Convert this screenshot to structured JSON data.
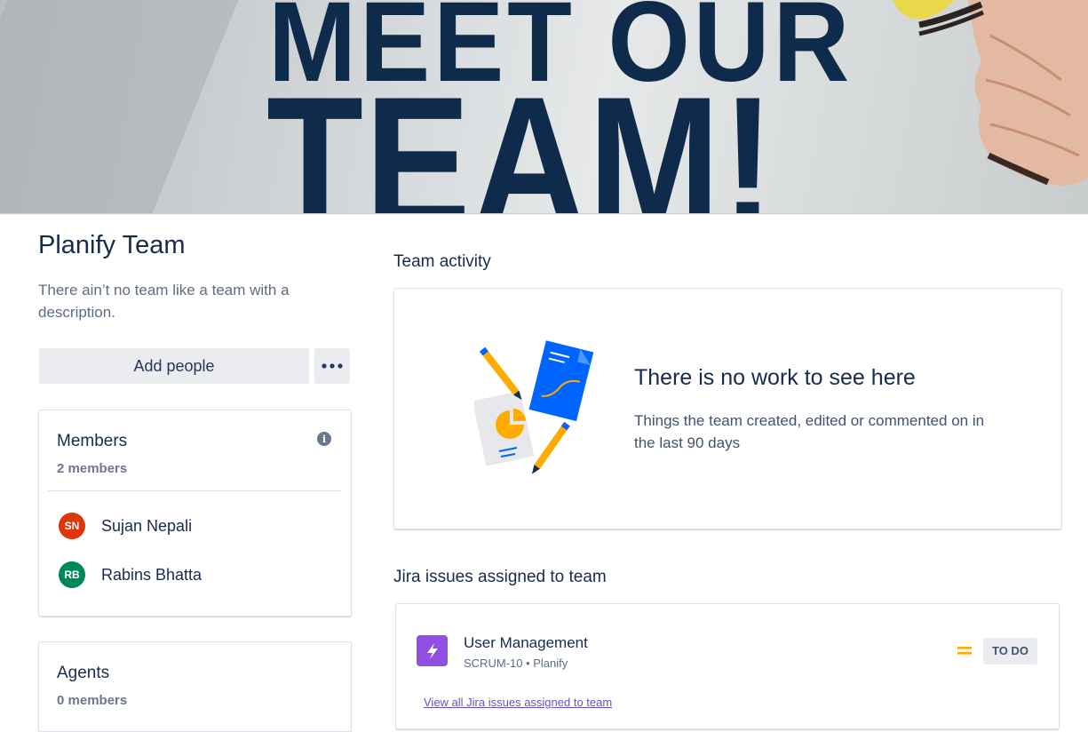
{
  "banner": {
    "line1": "MEET OUR",
    "line2": "TEAM!"
  },
  "team": {
    "name": "Planify Team",
    "description": "There ain’t no team like a team with a description.",
    "add_people_label": "Add people"
  },
  "members": {
    "title": "Members",
    "count": "2 members",
    "list": [
      {
        "initials": "SN",
        "name": "Sujan Nepali",
        "color": "#DE350B"
      },
      {
        "initials": "RB",
        "name": "Rabins Bhatta",
        "color": "#00875A"
      }
    ]
  },
  "agents": {
    "title": "Agents",
    "count": "0 members"
  },
  "activity": {
    "title": "Team activity",
    "empty_title": "There is no work to see here",
    "empty_desc": "Things the team created, edited or commented on in the last 90 days"
  },
  "issues": {
    "title": "Jira issues assigned to team",
    "items": [
      {
        "title": "User Management",
        "meta": "SCRUM-10 • Planify",
        "status": "TO DO",
        "icon": "epic-lightning-icon",
        "priority_icon": "priority-medium-icon"
      }
    ],
    "view_all": "View all Jira issues assigned to team"
  },
  "colors": {
    "text": "#172B4D",
    "subtle": "#5E6C84",
    "epic": "#904EE2",
    "priority": "#FFAB00",
    "link": "#6554C0",
    "banner_text": "#0f2b4c"
  }
}
